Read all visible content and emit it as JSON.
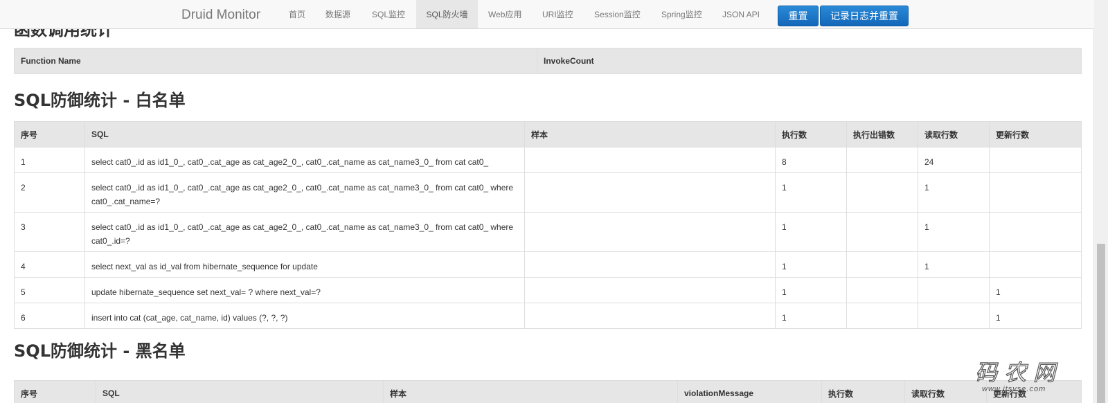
{
  "navbar": {
    "brand": "Druid Monitor",
    "items": [
      {
        "label": "首页"
      },
      {
        "label": "数据源"
      },
      {
        "label": "SQL监控"
      },
      {
        "label": "SQL防火墙"
      },
      {
        "label": "Web应用"
      },
      {
        "label": "URI监控"
      },
      {
        "label": "Session监控"
      },
      {
        "label": "Spring监控"
      },
      {
        "label": "JSON API"
      }
    ],
    "active_index": 3,
    "reset_label": "重置",
    "log_reset_label": "记录日志并重置",
    "button_color": "#1a78c9"
  },
  "function_section": {
    "title": "函数调用统计",
    "headers": [
      "Function Name",
      "InvokeCount"
    ]
  },
  "whitelist_section": {
    "title": "SQL防御统计 - 白名单",
    "headers": [
      "序号",
      "SQL",
      "样本",
      "执行数",
      "执行出错数",
      "读取行数",
      "更新行数"
    ],
    "rows": [
      {
        "no": "1",
        "sql": "select cat0_.id as id1_0_, cat0_.cat_age as cat_age2_0_, cat0_.cat_name as cat_name3_0_ from cat cat0_",
        "sample": "",
        "exec": "8",
        "error": "",
        "read": "24",
        "update": ""
      },
      {
        "no": "2",
        "sql": "select cat0_.id as id1_0_, cat0_.cat_age as cat_age2_0_, cat0_.cat_name as cat_name3_0_ from cat cat0_ where cat0_.cat_name=?",
        "sample": "",
        "exec": "1",
        "error": "",
        "read": "1",
        "update": ""
      },
      {
        "no": "3",
        "sql": "select cat0_.id as id1_0_, cat0_.cat_age as cat_age2_0_, cat0_.cat_name as cat_name3_0_ from cat cat0_ where cat0_.id=?",
        "sample": "",
        "exec": "1",
        "error": "",
        "read": "1",
        "update": ""
      },
      {
        "no": "4",
        "sql": "select next_val as id_val from hibernate_sequence for update",
        "sample": "",
        "exec": "1",
        "error": "",
        "read": "1",
        "update": ""
      },
      {
        "no": "5",
        "sql": "update hibernate_sequence set next_val= ? where next_val=?",
        "sample": "",
        "exec": "1",
        "error": "",
        "read": "",
        "update": "1"
      },
      {
        "no": "6",
        "sql": "insert into cat (cat_age, cat_name, id) values (?, ?, ?)",
        "sample": "",
        "exec": "1",
        "error": "",
        "read": "",
        "update": "1"
      }
    ]
  },
  "blacklist_section": {
    "title": "SQL防御统计 - 黑名单",
    "headers": [
      "序号",
      "SQL",
      "样本",
      "violationMessage",
      "执行数",
      "读取行数",
      "更新行数"
    ]
  },
  "watermark": {
    "text": "码农网",
    "sub": "www.itsvse.com"
  }
}
